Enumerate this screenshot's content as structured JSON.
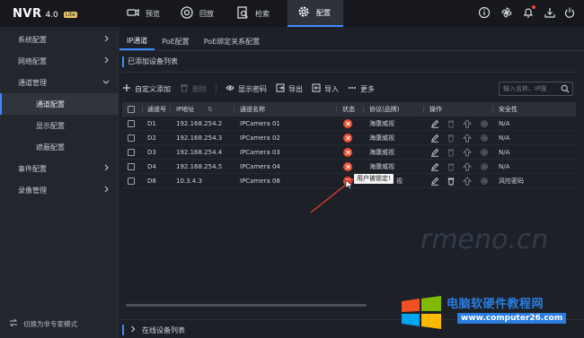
{
  "topbar": {
    "brand": "NVR",
    "version": "4.0",
    "edition": "Lite",
    "tabs": [
      {
        "label": "预览",
        "icon": "camera-icon"
      },
      {
        "label": "回放",
        "icon": "playback-icon"
      },
      {
        "label": "检索",
        "icon": "search-doc-icon"
      },
      {
        "label": "配置",
        "icon": "gear-icon"
      }
    ],
    "right_icons": [
      "info-icon",
      "settings-fan-icon",
      "bell-icon",
      "download-icon",
      "power-icon"
    ]
  },
  "sidebar": {
    "items": [
      {
        "label": "系统配置"
      },
      {
        "label": "网络配置"
      },
      {
        "label": "通道管理"
      },
      {
        "label": "通道配置"
      },
      {
        "label": "显示配置"
      },
      {
        "label": "遮蔽配置"
      },
      {
        "label": "事件配置"
      },
      {
        "label": "录像管理"
      }
    ],
    "footer": "切换为非专家模式"
  },
  "content_tabs": [
    "IP通道",
    "PoE配置",
    "PoE绑定关系配置"
  ],
  "section_title": "已添加设备列表",
  "toolbar": {
    "add": "自定义添加",
    "delete": "删除",
    "show_password": "显示密码",
    "export": "导出",
    "import": "导入",
    "more": "更多",
    "search_placeholder": "输入名称、IP搜"
  },
  "table": {
    "headers": [
      "通道号",
      "IP地址",
      "通道名称",
      "状态",
      "协议(品牌)",
      "操作",
      "安全性"
    ],
    "rows": [
      {
        "ch": "D1",
        "ip": "192.168.254.2",
        "name": "IPCamera 01",
        "protocol": "海康威视",
        "security": "N/A"
      },
      {
        "ch": "D2",
        "ip": "192.168.254.3",
        "name": "IPCamera 02",
        "protocol": "海康威视",
        "security": "N/A"
      },
      {
        "ch": "D3",
        "ip": "192.168.254.4",
        "name": "IPCamera 03",
        "protocol": "海康威视",
        "security": "N/A"
      },
      {
        "ch": "D4",
        "ip": "192.168.254.5",
        "name": "IPCamera 04",
        "protocol": "海康威视",
        "security": "N/A"
      },
      {
        "ch": "D8",
        "ip": "10.3.4.3",
        "name": "IPCamera 08",
        "protocol": "视",
        "security": "风险密码"
      }
    ]
  },
  "tooltip": "用户被锁定!",
  "bottom_section": "在线设备列表",
  "watermark": {
    "title": "电脑软硬件教程网",
    "url": "www.computer26.com",
    "faint": "rmeno.cn"
  },
  "colors": {
    "accent": "#3d8bff",
    "error": "#e8502f",
    "background": "#1d2027"
  }
}
